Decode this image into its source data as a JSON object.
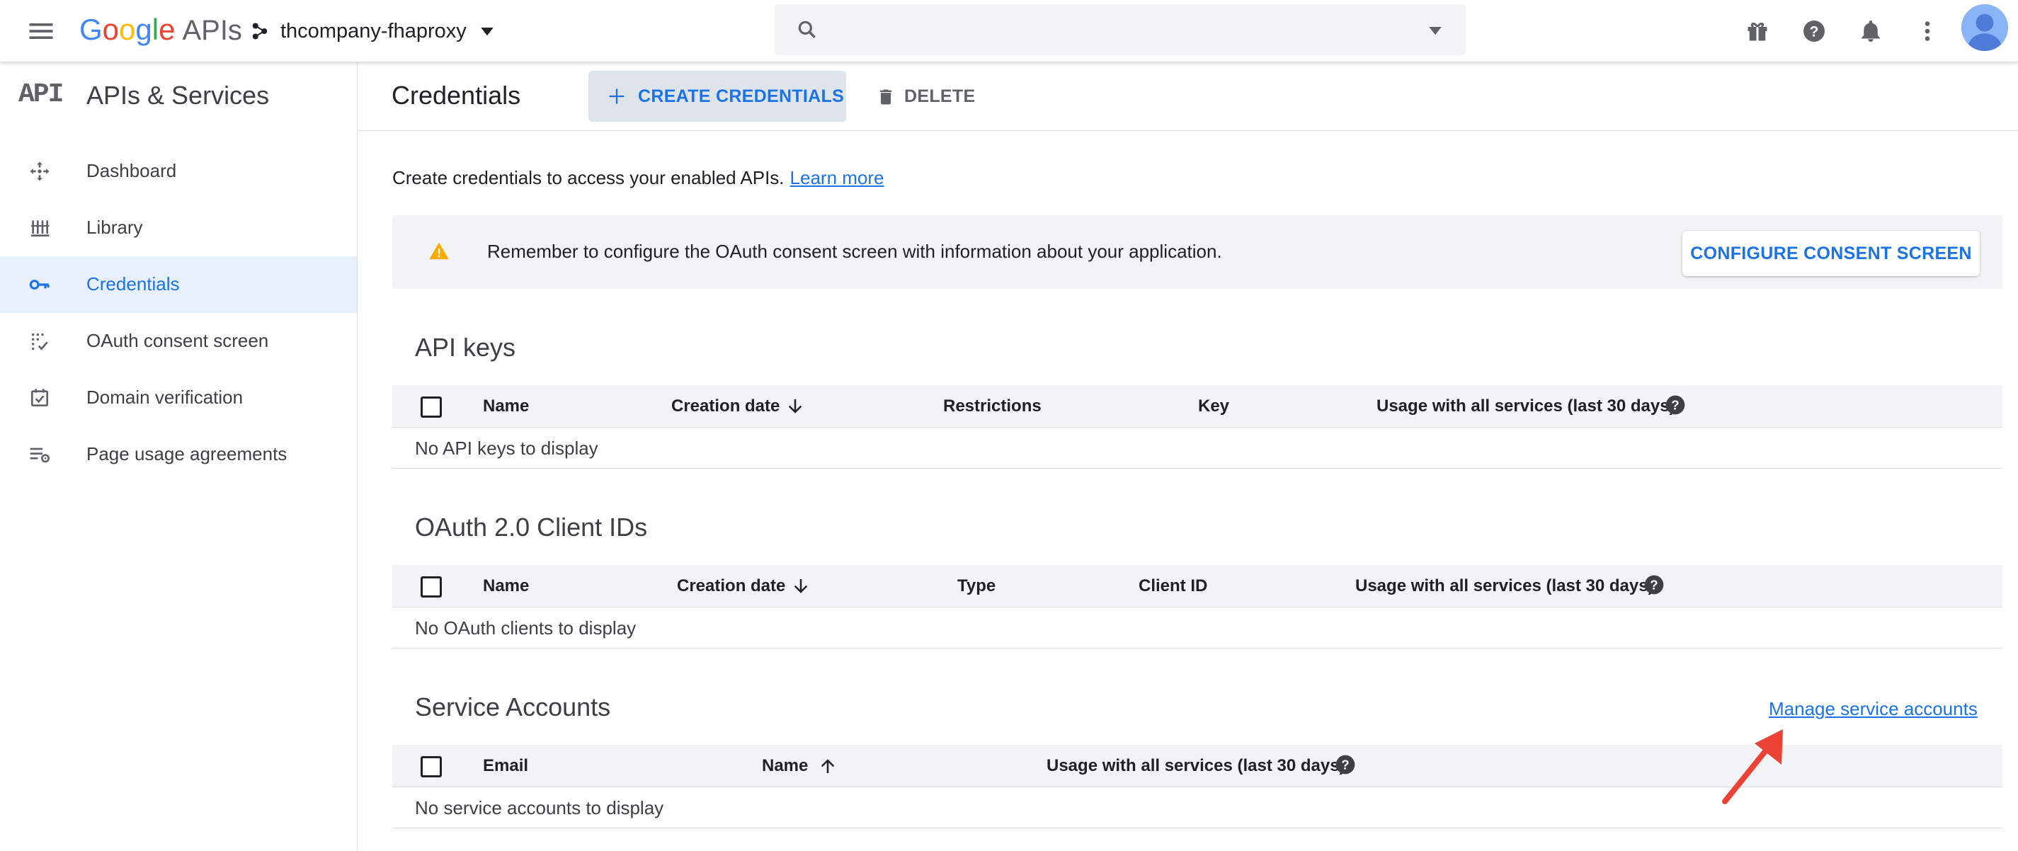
{
  "topbar": {
    "logo_letters": [
      "G",
      "o",
      "o",
      "g",
      "l",
      "e"
    ],
    "logo_suffix": "APIs",
    "project_name": "thcompany-fhaproxy",
    "search_placeholder": "",
    "icons": [
      "menu-icon",
      "project-icon",
      "search-icon",
      "gift-icon",
      "help-icon",
      "notifications-icon",
      "more-vert-icon",
      "avatar"
    ]
  },
  "sidebar": {
    "badge": "API",
    "title": "APIs & Services",
    "items": [
      {
        "label": "Dashboard",
        "icon": "dashboard-icon",
        "active": false
      },
      {
        "label": "Library",
        "icon": "library-icon",
        "active": false
      },
      {
        "label": "Credentials",
        "icon": "key-icon",
        "active": true
      },
      {
        "label": "OAuth consent screen",
        "icon": "consent-icon",
        "active": false
      },
      {
        "label": "Domain verification",
        "icon": "verification-icon",
        "active": false
      },
      {
        "label": "Page usage agreements",
        "icon": "settings-list-icon",
        "active": false
      }
    ]
  },
  "header": {
    "title": "Credentials",
    "create_label": "CREATE CREDENTIALS",
    "delete_label": "DELETE"
  },
  "intro": {
    "text": "Create credentials to access your enabled APIs.",
    "link": "Learn more"
  },
  "banner": {
    "message": "Remember to configure the OAuth consent screen with information about your application.",
    "button": "CONFIGURE CONSENT SCREEN"
  },
  "api_keys": {
    "title": "API keys",
    "columns": [
      "Name",
      "Creation date",
      "Restrictions",
      "Key",
      "Usage with all services (last 30 days)"
    ],
    "empty": "No API keys to display"
  },
  "oauth": {
    "title": "OAuth 2.0 Client IDs",
    "columns": [
      "Name",
      "Creation date",
      "Type",
      "Client ID",
      "Usage with all services (last 30 days)"
    ],
    "empty": "No OAuth clients to display"
  },
  "service_accounts": {
    "title": "Service Accounts",
    "manage_link": "Manage service accounts",
    "columns": [
      "Email",
      "Name",
      "Usage with all services (last 30 days)"
    ],
    "empty": "No service accounts to display"
  },
  "colors": {
    "accent": "#1a73e8",
    "active_bg": "#e8f0fe",
    "warning": "#f9ab00",
    "annotation_arrow": "#ea4335"
  }
}
